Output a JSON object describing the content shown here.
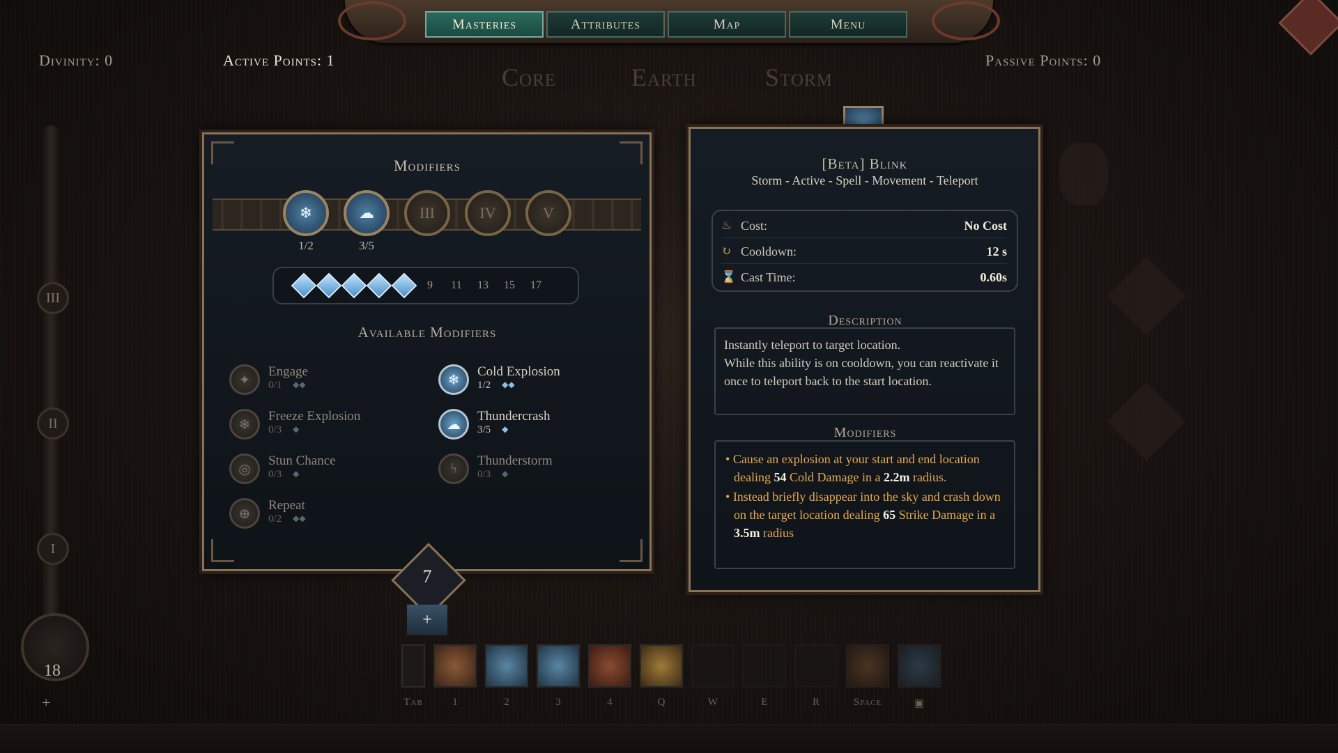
{
  "nav": {
    "tabs": [
      "Masteries",
      "Attributes",
      "Map",
      "Menu"
    ],
    "active": 0
  },
  "header": {
    "divinity": "Divinity: 0",
    "active_points": "Active Points: 1",
    "passive_points": "Passive Points: 0",
    "trees": [
      "Core",
      "Earth",
      "Storm"
    ]
  },
  "rail": {
    "nodes": [
      "III",
      "II",
      "I"
    ],
    "level": "18",
    "plus": "+"
  },
  "modifiers_panel": {
    "title": "Modifiers",
    "slots": [
      {
        "label": "",
        "count": "1/2",
        "active": true,
        "icon": "snowflake-icon"
      },
      {
        "label": "",
        "count": "3/5",
        "active": true,
        "icon": "thunder-cloud-icon"
      },
      {
        "label": "III",
        "count": "",
        "active": false
      },
      {
        "label": "IV",
        "count": "",
        "active": false
      },
      {
        "label": "V",
        "count": "",
        "active": false
      }
    ],
    "track_numbers": [
      "9",
      "11",
      "13",
      "15",
      "17"
    ],
    "track_filled": 5,
    "available_title": "Available Modifiers",
    "left_mods": [
      {
        "name": "Engage",
        "count": "0/1",
        "dots": "◆◆",
        "active": false
      },
      {
        "name": "Freeze Explosion",
        "count": "0/3",
        "dots": "◆",
        "active": false
      },
      {
        "name": "Stun Chance",
        "count": "0/3",
        "dots": "◆",
        "active": false
      },
      {
        "name": "Repeat",
        "count": "0/2",
        "dots": "◆◆",
        "active": false
      }
    ],
    "right_mods": [
      {
        "name": "Cold Explosion",
        "count": "1/2",
        "dots": "◆◆",
        "active": true
      },
      {
        "name": "Thundercrash",
        "count": "3/5",
        "dots": "◆",
        "active": true
      },
      {
        "name": "Thunderstorm",
        "count": "0/3",
        "dots": "◆",
        "active": false
      }
    ],
    "badge_value": "7",
    "plus": "+"
  },
  "skill": {
    "name": "[Beta] Blink",
    "tags": "Storm - Active - Spell - Movement - Teleport",
    "stats": [
      {
        "icon": "cost-icon",
        "label": "Cost:",
        "value": "No Cost"
      },
      {
        "icon": "cooldown-icon",
        "label": "Cooldown:",
        "value": "12 s"
      },
      {
        "icon": "hourglass-icon",
        "label": "Cast Time:",
        "value": "0.60s"
      }
    ],
    "description_title": "Description",
    "description": "Instantly teleport to target location.\nWhile this ability is on cooldown, you can reactivate it once to teleport back to the start location.",
    "modifiers_title": "Modifiers",
    "mod_lines": [
      {
        "a": "Cause an explosion at your start and end location dealing ",
        "b": "54",
        "c": " Cold Damage in a ",
        "d": "2.2m",
        "e": " radius."
      },
      {
        "a": "Instead briefly disappear into the sky and crash down on the target location dealing ",
        "b": "65",
        "c": " Strike Damage in a ",
        "d": "3.5m",
        "e": " radius"
      }
    ]
  },
  "hotbar": {
    "keys": [
      "Tab",
      "1",
      "2",
      "3",
      "4",
      "Q",
      "W",
      "E",
      "R",
      "Space"
    ]
  }
}
